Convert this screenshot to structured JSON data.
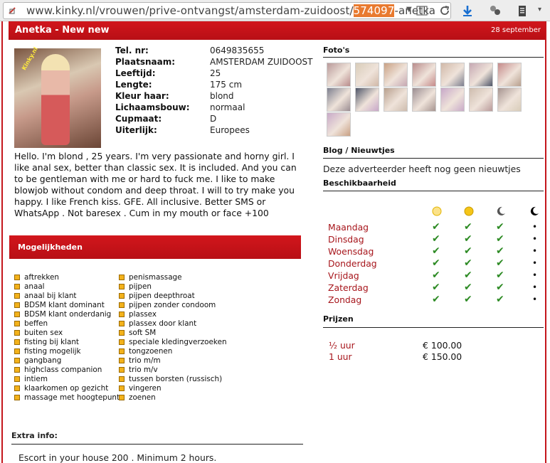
{
  "browser": {
    "url_prefix": "www.kinky.nl/vrouwen/prive-ontvangst/amsterdam-zuidoost/",
    "url_highlight": "574097",
    "url_suffix": "-anetka",
    "icons": [
      "page-info-icon",
      "dropdown-icon",
      "reader-view-icon",
      "reload-icon",
      "download-icon",
      "extensions-icon",
      "clipboard-icon"
    ]
  },
  "header": {
    "title": "Anetka - New new",
    "date": "28 september"
  },
  "profile": {
    "photo_stamp": "Kinky.nl",
    "fields": [
      {
        "label": "Tel. nr:",
        "value": "0649835655"
      },
      {
        "label": "Plaatsnaam:",
        "value": "AMSTERDAM ZUIDOOST"
      },
      {
        "label": "Leeftijd:",
        "value": "25"
      },
      {
        "label": "Lengte:",
        "value": "175 cm"
      },
      {
        "label": "Kleur haar:",
        "value": "blond"
      },
      {
        "label": "Lichaamsbouw:",
        "value": "normaal"
      },
      {
        "label": "Cupmaat:",
        "value": "D"
      },
      {
        "label": "Uiterlijk:",
        "value": "Europees"
      }
    ],
    "description": "Hello. I'm blond , 25 years. I'm very passionate and horny girl. I like anal sex, better than classic sex. It is included. And you can to be gentleman with me or hard to fuck me. I like to make blowjob without condom and deep throat. I will to try make you happy. I like French kiss. GFE. All inclusive. Better SMS or WhatsApp . Not baresex . Cum in my mouth or face +100"
  },
  "services": {
    "title": "Mogelijkheden",
    "col1": [
      "aftrekken",
      "anaal",
      "anaal bij klant",
      "BDSM klant dominant",
      "BDSM klant onderdanig",
      "beffen",
      "buiten sex",
      "fisting bij klant",
      "fisting mogelijk",
      "gangbang",
      "highclass companion",
      "intiem",
      "klaarkomen op gezicht",
      "massage met hoogtepunt"
    ],
    "col2": [
      "penismassage",
      "pijpen",
      "pijpen deepthroat",
      "pijpen zonder condoom",
      "plassex",
      "plassex door klant",
      "soft SM",
      "speciale kledingverzoeken",
      "tongzoenen",
      "trio m/m",
      "trio m/v",
      "tussen borsten (russisch)",
      "vingeren",
      "zoenen"
    ]
  },
  "extra": {
    "title": "Extra info:",
    "text": "Escort in your house 200 . Minimum 2 hours."
  },
  "photos": {
    "title": "Foto's",
    "count": 15
  },
  "blog": {
    "title": "Blog / Nieuwtjes",
    "text": "Deze adverteerder heeft nog geen nieuwtjes"
  },
  "availability": {
    "title": "Beschikbaarheid",
    "periods": [
      "morning-sun-icon",
      "afternoon-sun-icon",
      "evening-moon-icon",
      "night-moon-icon"
    ],
    "days": [
      "Maandag",
      "Dinsdag",
      "Woensdag",
      "Donderdag",
      "Vrijdag",
      "Zaterdag",
      "Zondag"
    ],
    "check_mark": "✔",
    "dot_mark": "•"
  },
  "prices": {
    "title": "Prijzen",
    "rows": [
      {
        "label": "½  uur",
        "price": "€ 100.00"
      },
      {
        "label": "1   uur",
        "price": "€ 150.00"
      }
    ]
  },
  "colors": {
    "accent": "#c4161c",
    "day_text": "#a7161c",
    "check": "#2c8a23",
    "bullet": "#f3b21b"
  }
}
